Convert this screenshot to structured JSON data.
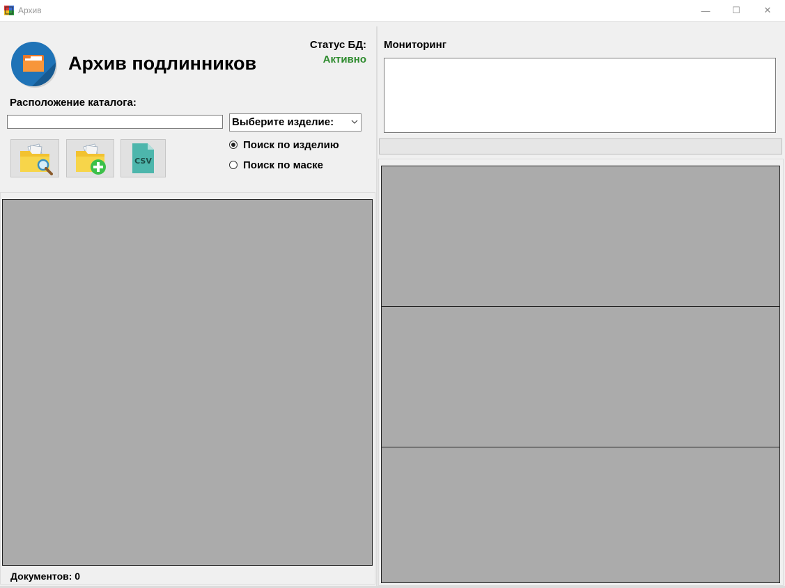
{
  "window": {
    "title": "Архив",
    "minimize_glyph": "—",
    "maximize_glyph": "☐",
    "close_glyph": "✕"
  },
  "header": {
    "app_title": "Архив подлинников",
    "db_status_label": "Статус БД:",
    "db_status_value": "Активно",
    "db_status_color": "#2e8b2e"
  },
  "catalog": {
    "label": "Расположение каталога:",
    "path_value": "",
    "product_select_value": "Выберите изделие:"
  },
  "toolbar": {
    "search_icon": "folder-search-icon",
    "add_icon": "folder-add-icon",
    "csv_icon": "csv-file-icon",
    "csv_text": "CSV"
  },
  "search_mode": {
    "options": [
      "Поиск по изделию",
      "Поиск по маске"
    ],
    "selected_index": 0
  },
  "documents": {
    "count_text": "Документов: 0"
  },
  "monitoring": {
    "label": "Мониторинг",
    "log_text": "",
    "progress_percent": 0
  }
}
